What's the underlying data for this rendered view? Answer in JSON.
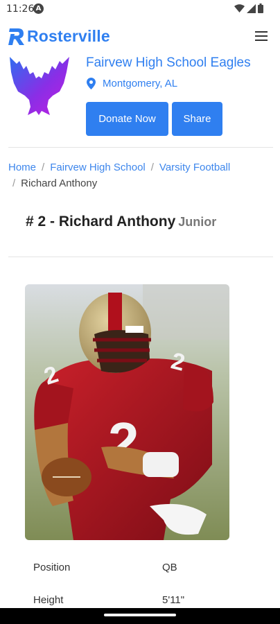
{
  "status_bar": {
    "time": "11:26",
    "indicator_letter": "A"
  },
  "header": {
    "brand": "Rosterville"
  },
  "school": {
    "name": "Fairvew High School Eagles",
    "location": "Montgomery, AL"
  },
  "actions": {
    "donate_label": "Donate Now",
    "share_label": "Share"
  },
  "breadcrumb": {
    "items": [
      "Home",
      "Fairvew High School",
      "Varsity Football"
    ],
    "current": "Richard Anthony",
    "separator": "/"
  },
  "player": {
    "heading": "# 2 - Richard Anthony",
    "class_year": "Junior"
  },
  "stats": [
    {
      "label": "Position",
      "value": "QB"
    },
    {
      "label": "Height",
      "value": "5'11\""
    }
  ],
  "colors": {
    "accent": "#2f7ff0",
    "logo_gradient_start": "#2f6cf0",
    "logo_gradient_end": "#c21ee0"
  }
}
